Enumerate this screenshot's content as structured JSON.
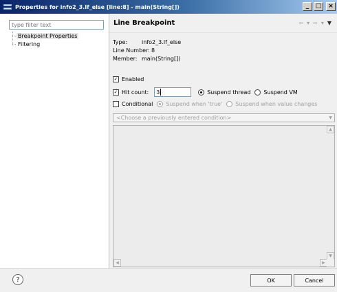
{
  "window": {
    "title": "Properties for info2_3.If_else [line:8] - main(String[])"
  },
  "window_buttons": {
    "minimize": "_",
    "maximize": "□",
    "close": "×"
  },
  "filter": {
    "placeholder": "type filter text"
  },
  "tree": {
    "items": [
      {
        "label": "Breakpoint Properties",
        "selected": true
      },
      {
        "label": "Filtering",
        "selected": false
      }
    ]
  },
  "page": {
    "title": "Line Breakpoint",
    "nav_icons": [
      "back-arrow-icon",
      "dropdown-icon",
      "forward-arrow-icon",
      "dropdown-icon",
      "menu-dropdown-icon"
    ]
  },
  "info": {
    "type_label": "Type:",
    "type_value": "info2_3.If_else",
    "line_label": "Line Number:",
    "line_value": "8",
    "member_label": "Member:",
    "member_value": "main(String[])"
  },
  "options": {
    "enabled_label": "Enabled",
    "enabled_checked": true,
    "hit_count_label": "Hit count:",
    "hit_count_checked": true,
    "hit_count_value": "3",
    "suspend_thread_label": "Suspend thread",
    "suspend_vm_label": "Suspend VM",
    "suspend_selected": "thread",
    "conditional_label": "Conditional",
    "conditional_checked": false,
    "suspend_true_label": "Suspend when 'true'",
    "suspend_changes_label": "Suspend when value changes",
    "condition_placeholder": "<Choose a previously entered condition>"
  },
  "footer": {
    "help_label": "?",
    "ok_label": "OK",
    "cancel_label": "Cancel"
  }
}
